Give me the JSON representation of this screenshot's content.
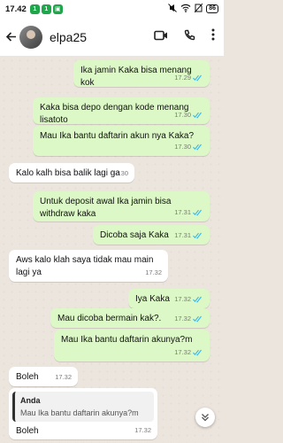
{
  "status_bar": {
    "time": "17.42",
    "notif_badges": [
      "1",
      "1",
      "▣"
    ],
    "battery": "86"
  },
  "header": {
    "contact_name": "elpa25",
    "icons": [
      "back-arrow-icon",
      "video-call-icon",
      "phone-icon",
      "more-vertical-icon"
    ]
  },
  "messages": [
    {
      "dir": "out",
      "text": "Ika jamin Kaka bisa menang kok",
      "time": "17.29",
      "read": true
    },
    {
      "dir": "out",
      "text": "Kaka bisa depo dengan kode menang lisatoto",
      "time": "17.30",
      "read": true
    },
    {
      "dir": "out",
      "text": "Mau Ika bantu daftarin akun nya Kaka?",
      "time": "17.30",
      "read": true
    },
    {
      "dir": "in",
      "text": "Kalo kalh bisa balik lagi ga",
      "time": "17.30"
    },
    {
      "dir": "out",
      "text": "Untuk deposit awal Ika jamin bisa withdraw kaka",
      "time": "17.31",
      "read": true
    },
    {
      "dir": "out",
      "text": "Dicoba saja Kaka",
      "time": "17.31",
      "read": true
    },
    {
      "dir": "in",
      "text": "Aws kalo klah saya tidak mau main lagi ya",
      "time": "17.32"
    },
    {
      "dir": "out",
      "text": "Iya Kaka",
      "time": "17.32",
      "read": true
    },
    {
      "dir": "out",
      "text": "Mau dicoba bermain kak?.",
      "time": "17.32",
      "read": true
    },
    {
      "dir": "out",
      "text": "Mau Ika bantu daftarin akunya?m",
      "time": "17.32",
      "read": true
    },
    {
      "dir": "in",
      "text": "Boleh",
      "time": "17.32"
    },
    {
      "dir": "in",
      "text": "Boleh",
      "time": "17.32",
      "quote": {
        "author": "Anda",
        "text": "Mau Ika bantu daftarin akunya?m"
      }
    }
  ],
  "colors": {
    "outgoing_bubble": "#dcf8c6",
    "incoming_bubble": "#ffffff",
    "read_ticks": "#34b7f1",
    "chat_background": "#ece5dd"
  }
}
